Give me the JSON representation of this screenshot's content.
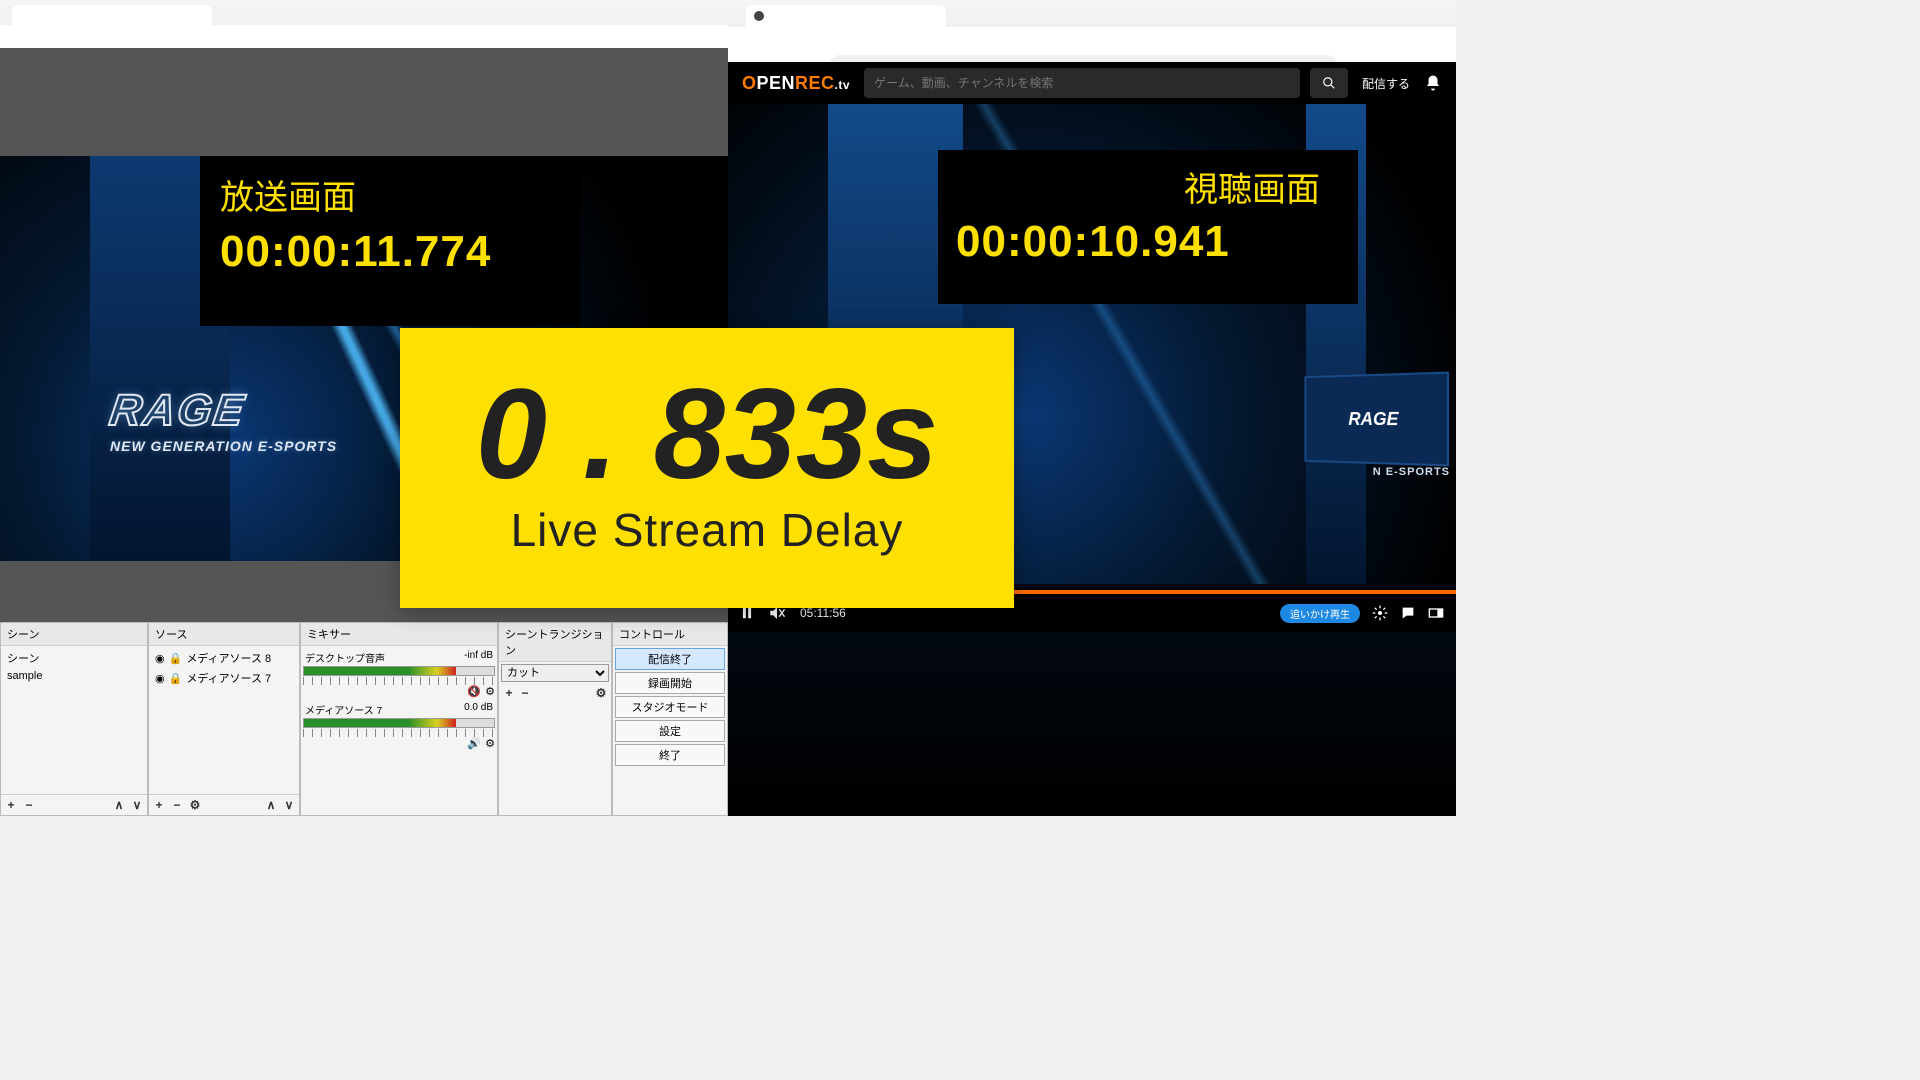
{
  "left": {
    "preview": {
      "overlay_label": "放送画面",
      "overlay_time": "00:00:11.774",
      "stage_logo": "RAGE",
      "stage_sub": "NEW GENERATION E-SPORTS"
    },
    "panels": {
      "scenes": {
        "header": "シーン",
        "items": [
          "シーン",
          "sample"
        ]
      },
      "sources": {
        "header": "ソース",
        "items": [
          "メディアソース 8",
          "メディアソース 7"
        ]
      },
      "mixer": {
        "header": "ミキサー",
        "channels": [
          {
            "name": "デスクトップ音声",
            "level": "-inf dB"
          },
          {
            "name": "メディアソース 7",
            "level": "0.0 dB"
          }
        ]
      },
      "transition": {
        "header": "シーントランジション",
        "selected": "カット"
      },
      "controls": {
        "header": "コントロール",
        "buttons": [
          "配信終了",
          "録画開始",
          "スタジオモード",
          "設定",
          "終了"
        ]
      }
    }
  },
  "right": {
    "brand": {
      "o": "O",
      "pen": "PEN",
      "rec": "REC",
      "tv": ".tv"
    },
    "search_placeholder": "ゲーム、動画、チャンネルを検索",
    "stream_link": "配信する",
    "viewer": {
      "overlay_label": "視聴画面",
      "overlay_time": "00:00:10.941",
      "sub": "N E-SPORTS",
      "mini_logo": "RAGE"
    },
    "player": {
      "time": "05:11:56",
      "badge": "追いかけ再生"
    }
  },
  "delay": {
    "value": "0 . 833s",
    "label": "Live Stream Delay"
  }
}
